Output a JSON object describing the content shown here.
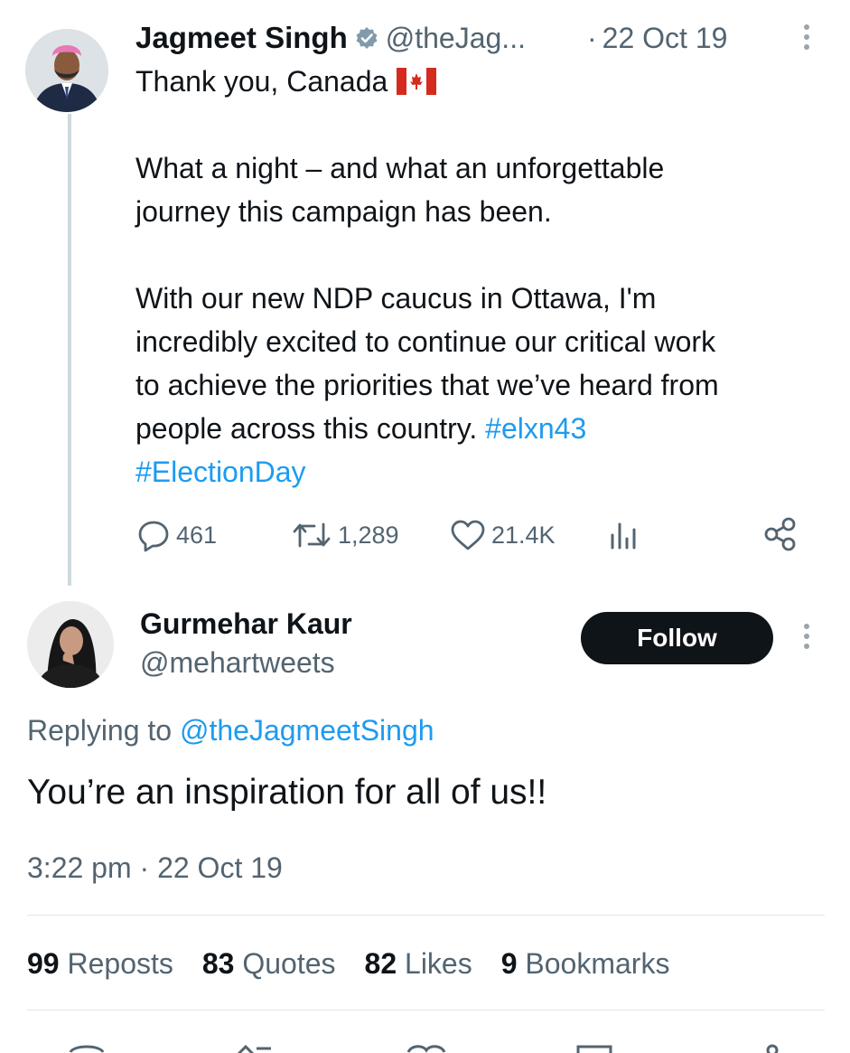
{
  "original_tweet": {
    "author_name": "Jagmeet Singh",
    "author_handle": "@theJag...",
    "separator": "·",
    "date": "22 Oct 19",
    "first_line": "Thank you, Canada",
    "paragraph_1_line_1": "What a night – and what an unforgettable",
    "paragraph_1_line_2": "journey this campaign has been.",
    "paragraph_2_line_1": "With our new NDP caucus in Ottawa, I'm",
    "paragraph_2_line_2": "incredibly excited to continue our critical work",
    "paragraph_2_line_3": "to achieve the priorities that we’ve heard from",
    "paragraph_2_line_4": "people across this country.",
    "hashtag_1": "#elxn43",
    "hashtag_2": "#ElectionDay",
    "replies_count": "461",
    "reposts_count": "1,289",
    "likes_count": "21.4K"
  },
  "reply_tweet": {
    "author_name": "Gurmehar Kaur",
    "author_handle": "@mehartweets",
    "follow_label": "Follow",
    "replying_to_label": "Replying to",
    "replying_to_handle": "@theJagmeetSingh",
    "text": "You’re an inspiration for all of us!!",
    "time": "3:22 pm",
    "separator": "·",
    "date": "22 Oct 19"
  },
  "stats": {
    "reposts_num": "99",
    "reposts_label": "Reposts",
    "quotes_num": "83",
    "quotes_label": "Quotes",
    "likes_num": "82",
    "likes_label": "Likes",
    "bookmarks_num": "9",
    "bookmarks_label": "Bookmarks"
  },
  "icons": {
    "verified": "verified-badge-icon",
    "flag": "canada-flag-icon",
    "reply": "reply-icon",
    "repost": "repost-icon",
    "like": "heart-icon",
    "views": "views-bar-chart-icon",
    "share": "share-icon",
    "more": "more-vertical-icon"
  },
  "colors": {
    "link": "#1d9bf0",
    "muted": "#536471",
    "text": "#0f1419",
    "follow_bg": "#0f1419"
  }
}
